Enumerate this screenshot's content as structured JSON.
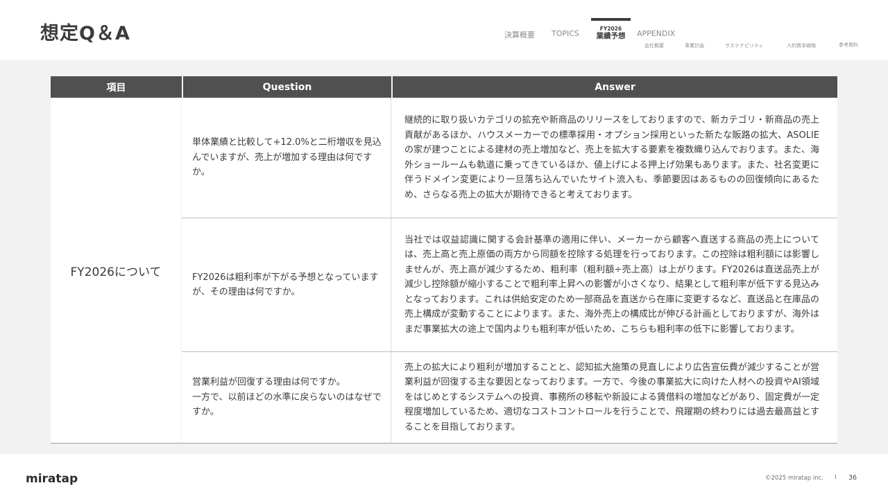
{
  "header": {
    "title": "想定Q＆A",
    "nav": {
      "item1": "決算概要",
      "item2": "TOPICS",
      "active_sub": "FY2026",
      "active_main": "業績予想",
      "item4": "APPENDIX",
      "sub1": "会社概要",
      "sub2": "事業計画",
      "sub3": "サステナビリティ",
      "sub4": "人的資本戦略",
      "sub5": "参考資料"
    }
  },
  "table": {
    "headers": {
      "topic": "項目",
      "question": "Question",
      "answer": "Answer"
    },
    "topic": "FY2026について",
    "rows": [
      {
        "question": "単体業績と比較して+12.0%と二桁増収を見込んでいますが、売上が増加する理由は何ですか。",
        "answer": "継続的に取り扱いカテゴリの拡充や新商品のリリースをしておりますので、新カテゴリ・新商品の売上貢献があるほか、ハウスメーカーでの標準採用・オプション採用といった新たな販路の拡大、ASOLIEの家が建つことによる建材の売上増加など、売上を拡大する要素を複数織り込んでおります。また、海外ショールームも軌道に乗ってきているほか、値上げによる押上げ効果もあります。また、社名変更に伴うドメイン変更により一旦落ち込んでいたサイト流入も、季節要因はあるものの回復傾向にあるため、さらなる売上の拡大が期待できると考えております。"
      },
      {
        "question": "FY2026は粗利率が下がる予想となっていますが、その理由は何ですか。",
        "answer": "当社では収益認識に関する会計基準の適用に伴い、メーカーから顧客へ直送する商品の売上については、売上高と売上原価の両方から同額を控除する処理を行っております。この控除は粗利額には影響しませんが、売上高が減少するため、粗利率（粗利額÷売上高）は上がります。FY2026は直送品売上が減少し控除額が縮小することで粗利率上昇への影響が小さくなり、結果として粗利率が低下する見込みとなっております。これは供給安定のため一部商品を直送から在庫に変更するなど、直送品と在庫品の売上構成が変動することによります。また、海外売上の構成比が伸びる計画としておりますが、海外はまだ事業拡大の途上で国内よりも粗利率が低いため、こちらも粗利率の低下に影響しております。"
      },
      {
        "question_line1": "営業利益が回復する理由は何ですか。",
        "question_line2": "一方で、以前ほどの水準に戻らないのはなぜですか。",
        "answer": "売上の拡大により粗利が増加することと、認知拡大施策の見直しにより広告宣伝費が減少することが営業利益が回復する主な要因となっております。一方で、今後の事業拡大に向けた人材への投資やAI領域をはじめとするシステムへの投資、事務所の移転や新設による賃借料の増加などがあり、固定費が一定程度増加しているため、適切なコストコントロールを行うことで、飛躍期の終わりには過去最高益とすることを目指しております。"
      }
    ]
  },
  "footer": {
    "logo": "miratap",
    "copyright": "©2025 miratap inc.",
    "separator": "I",
    "page": "36"
  }
}
